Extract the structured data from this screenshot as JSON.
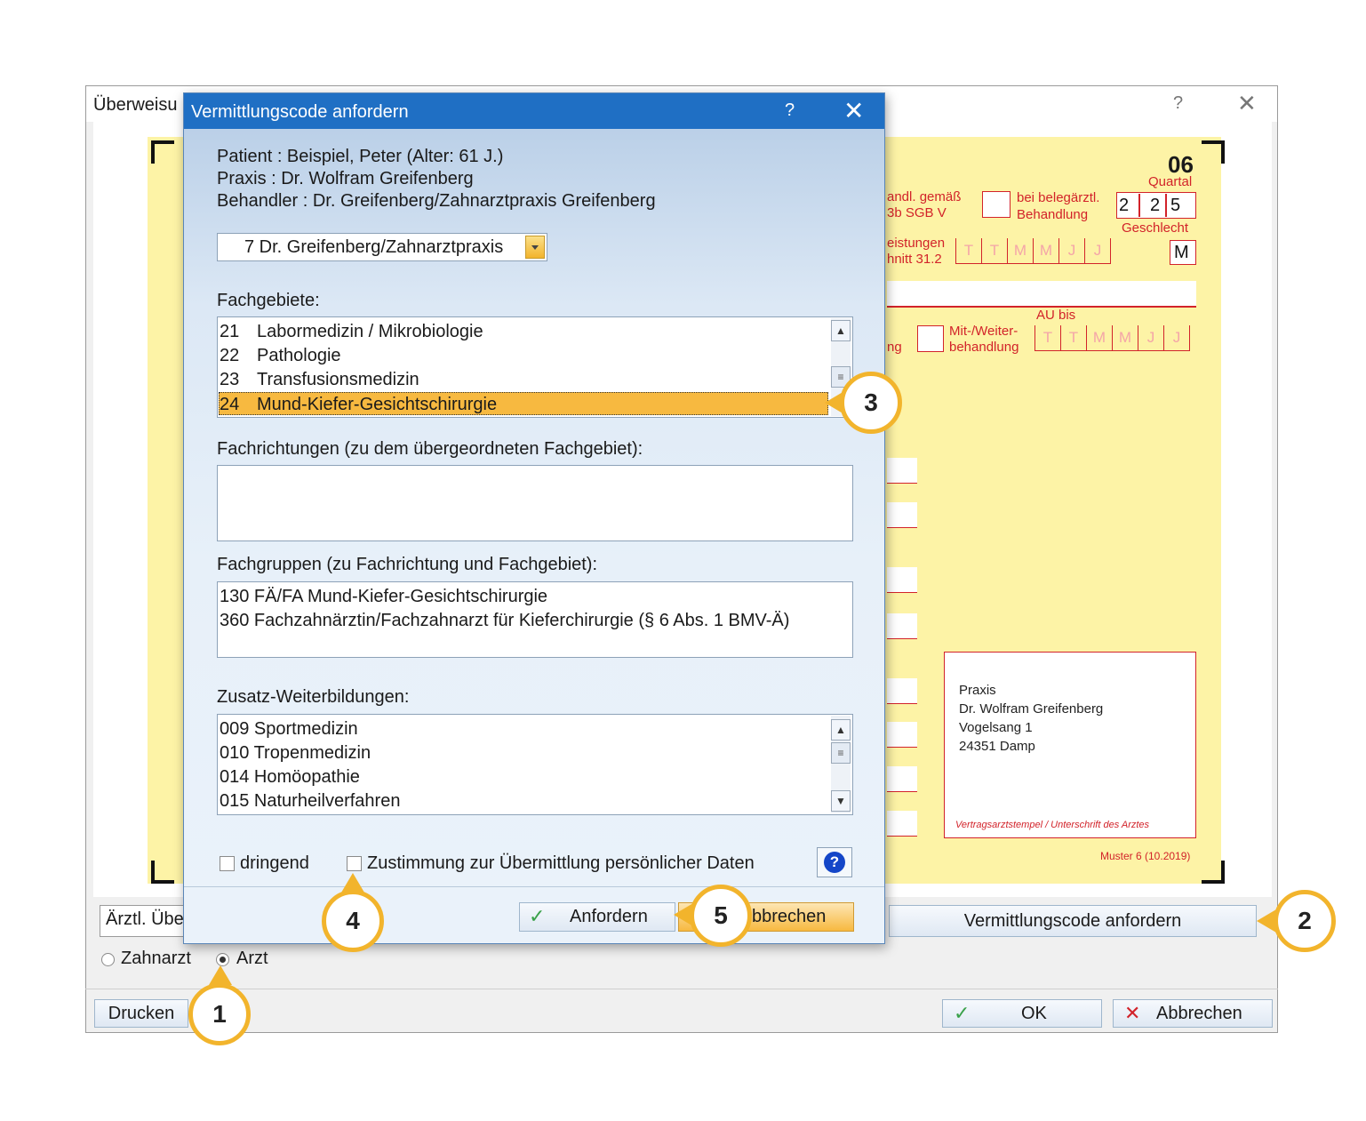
{
  "bg_window": {
    "title": "Überweisu",
    "help": "?",
    "close": "✕"
  },
  "form": {
    "quartal_num": "06",
    "quartal_label": "Quartal",
    "behandl_text1": "andl. gemäß",
    "behandl_text2": "3b SGB V",
    "beleg_text1": "bei belegärztl.",
    "beleg_text2": "Behandlung",
    "quartal_digits": [
      "2",
      "2",
      "5"
    ],
    "geschlecht_label": "Geschlecht",
    "geschlecht_value": "M",
    "leistungen_text1": "eistungen",
    "leistungen_text2": "hnitt 31.2",
    "date_placeholder": [
      "T",
      "T",
      "M",
      "M",
      "J",
      "J"
    ],
    "au_bis": "AU bis",
    "ng_text": "ng",
    "mitweiter1": "Mit-/Weiter-",
    "mitweiter2": "behandlung",
    "stamp_lines": [
      "Praxis",
      "Dr. Wolfram Greifenberg",
      "Vogelsang 1",
      "24351 Damp"
    ],
    "stamp_caption": "Vertragsarztstempel / Unterschrift des Arztes",
    "muster": "Muster 6 (10.2019)"
  },
  "bottom": {
    "arztl_field": "Ärztl. Übe",
    "vermittlung_button": "Vermittlungscode anfordern",
    "radio_zahnarzt": "Zahnarzt",
    "radio_arzt": "Arzt",
    "drucken": "Drucken",
    "ok": "OK",
    "abbrechen": "Abbrechen"
  },
  "dialog": {
    "title": "Vermittlungscode anfordern",
    "help": "?",
    "close": "✕",
    "patient": "Patient : Beispiel, Peter  (Alter: 61 J.)",
    "praxis": "Praxis : Dr. Wolfram Greifenberg",
    "behandler": "Behandler : Dr. Greifenberg/Zahnarztpraxis Greifenberg",
    "dropdown_value": "7 Dr. Greifenberg/Zahnarztpraxis",
    "fachgebiete_label": "Fachgebiete:",
    "fachgebiete": [
      {
        "code": "21",
        "name": "Labormedizin / Mikrobiologie"
      },
      {
        "code": "22",
        "name": "Pathologie"
      },
      {
        "code": "23",
        "name": "Transfusionsmedizin"
      },
      {
        "code": "24",
        "name": "Mund-Kiefer-Gesichtschirurgie"
      }
    ],
    "fachrichtungen_label": "Fachrichtungen (zu dem übergeordneten Fachgebiet):",
    "fachgruppen_label": "Fachgruppen (zu Fachrichtung und Fachgebiet):",
    "fachgruppen": [
      "130 FÄ/FA Mund-Kiefer-Gesichtschirurgie",
      "360 Fachzahnärztin/Fachzahnarzt für Kieferchirurgie (§ 6 Abs. 1 BMV-Ä)"
    ],
    "zusatz_label": "Zusatz-Weiterbildungen:",
    "zusatz": [
      "009 Sportmedizin",
      "010 Tropenmedizin",
      "014 Homöopathie",
      "015 Naturheilverfahren"
    ],
    "dringend": "dringend",
    "zustimmung": "Zustimmung zur Übermittlung persönlicher Daten",
    "info_icon_text": "?",
    "anfordern": "Anfordern",
    "abbrechen_partial": "bbrechen"
  },
  "callouts": [
    "1",
    "2",
    "3",
    "4",
    "5"
  ],
  "colors": {
    "accent_title": "#1f6fc4",
    "form_yellow": "#fdf3a6",
    "form_red": "#d2232a",
    "callout_ring": "#f2b42c",
    "selection": "#f7b940"
  }
}
